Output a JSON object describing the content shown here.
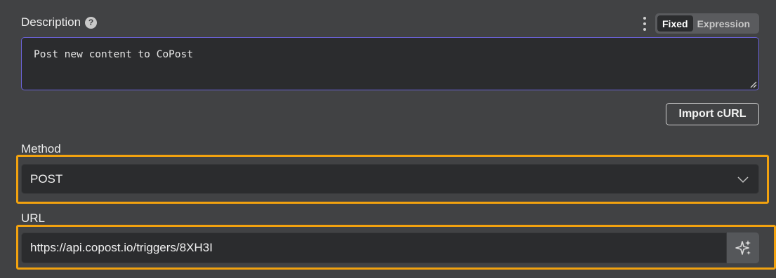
{
  "description": {
    "label": "Description",
    "help_icon": "question-circle-icon",
    "value": "Post new content to CoPost",
    "mode_fixed": "Fixed",
    "mode_expression": "Expression",
    "options_icon": "vertical-dots-icon"
  },
  "import_curl": {
    "label": "Import cURL"
  },
  "method": {
    "label": "Method",
    "selected": "POST",
    "dropdown_icon": "chevron-down-icon"
  },
  "url": {
    "label": "URL",
    "value": "https://api.copost.io/triggers/8XH3I",
    "ai_icon": "sparkles-icon"
  },
  "colors": {
    "background": "#414244",
    "input_background": "#2b2c2e",
    "focus_border": "#6b63d8",
    "highlight": "#f2a20f"
  }
}
